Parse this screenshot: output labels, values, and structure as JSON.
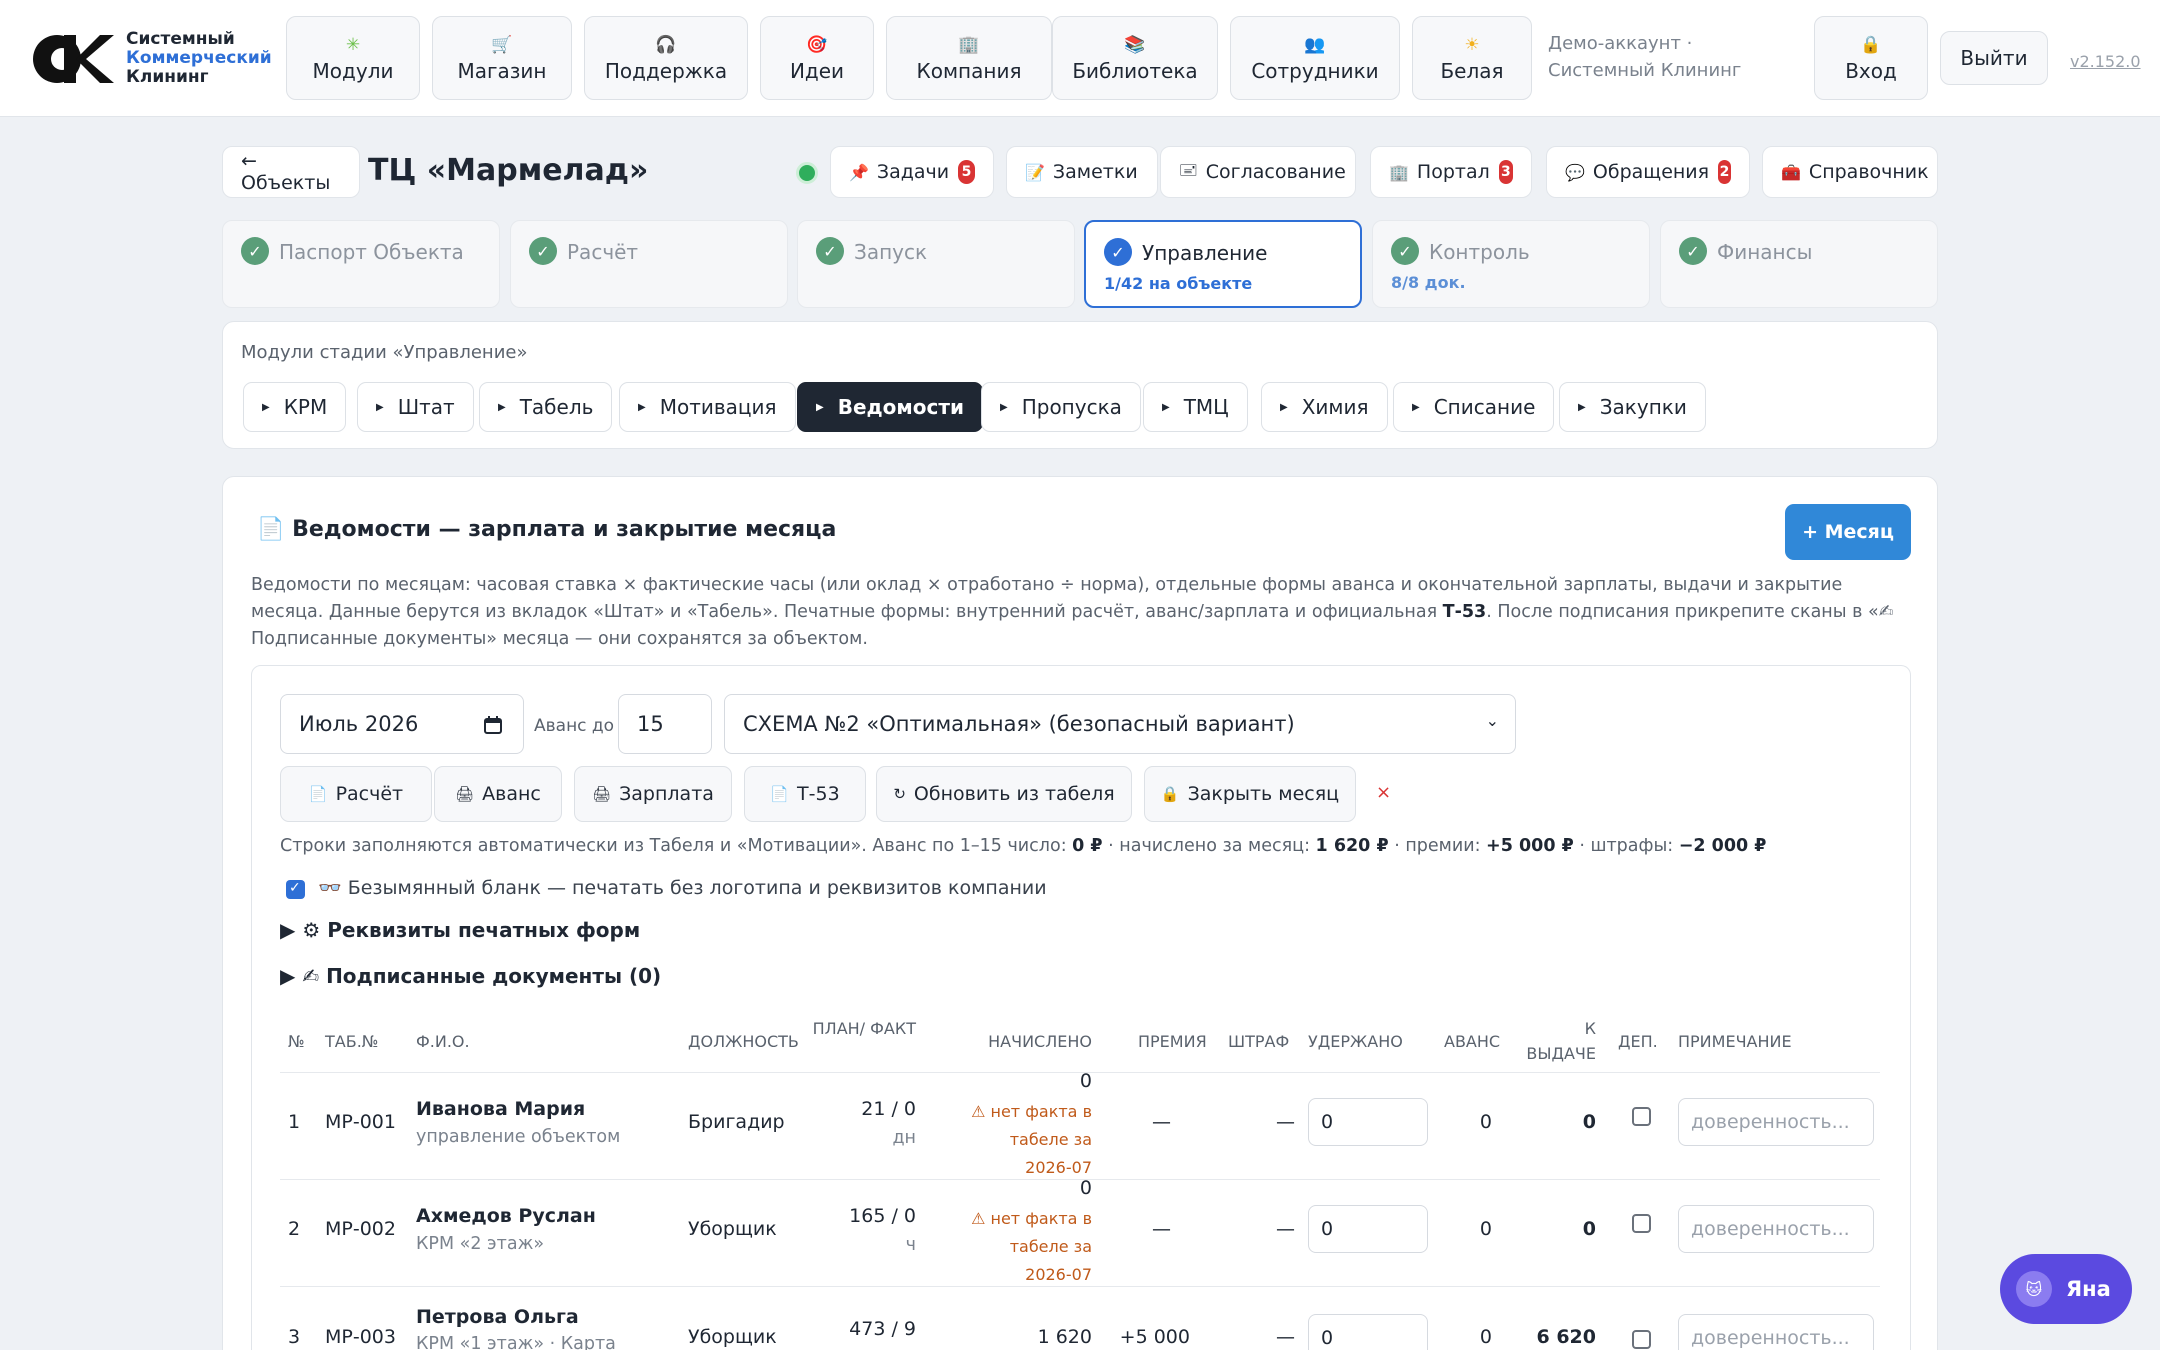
{
  "brand": {
    "line1": "Системный",
    "line2": "Коммерческий",
    "line3": "Клининг"
  },
  "nav": [
    {
      "label": "Модули",
      "icon": "puzzle-icon",
      "glyph": "✳"
    },
    {
      "label": "Магазин",
      "icon": "cart-icon",
      "glyph": "🛒"
    },
    {
      "label": "Поддержка",
      "icon": "headphones-icon",
      "glyph": "🎧"
    },
    {
      "label": "Идеи",
      "icon": "target-icon",
      "glyph": "🎯"
    },
    {
      "label": "Компания",
      "icon": "building-icon",
      "glyph": "🏢"
    },
    {
      "label": "Библиотека",
      "icon": "books-icon",
      "glyph": "📚"
    },
    {
      "label": "Сотрудники",
      "icon": "people-icon",
      "glyph": "👥"
    },
    {
      "label": "Белая",
      "icon": "sun-icon",
      "glyph": "☀"
    }
  ],
  "account": {
    "demo": "Демо-аккаунт · Системный Клининг",
    "login": "Вход",
    "login_glyph": "🔒",
    "logout": "Выйти",
    "version": "v2.152.0"
  },
  "header": {
    "back": "← Объекты",
    "title": "ТЦ «Мармелад»",
    "buttons": [
      {
        "label": "Задачи",
        "glyph": "📌",
        "icon": "pin-icon",
        "badge": "5"
      },
      {
        "label": "Заметки",
        "glyph": "📝",
        "icon": "note-icon"
      },
      {
        "label": "Согласование",
        "glyph": "🖃",
        "icon": "stamp-icon"
      },
      {
        "label": "Портал",
        "glyph": "🏢",
        "icon": "building-icon",
        "badge": "3"
      },
      {
        "label": "Обращения",
        "glyph": "💬",
        "icon": "speech-icon",
        "badge": "2"
      },
      {
        "label": "Справочник",
        "glyph": "🧰",
        "icon": "toolbox-icon"
      }
    ]
  },
  "stages": [
    {
      "label": "Паспорт Объекта",
      "sub": ""
    },
    {
      "label": "Расчёт",
      "sub": ""
    },
    {
      "label": "Запуск",
      "sub": ""
    },
    {
      "label": "Управление",
      "sub": "1/42 на объекте",
      "active": true
    },
    {
      "label": "Контроль",
      "sub": "8/8 док."
    },
    {
      "label": "Финансы",
      "sub": ""
    }
  ],
  "modules": {
    "caption": "Модули стадии «Управление»",
    "items": [
      "КРМ",
      "Штат",
      "Табель",
      "Мотивация",
      "Ведомости",
      "Пропуска",
      "ТМЦ",
      "Химия",
      "Списание",
      "Закупки"
    ],
    "active": "Ведомости"
  },
  "payroll": {
    "title": "Ведомости — зарплата и закрытие месяца",
    "title_glyph": "📄",
    "add_month": "+ Месяц",
    "desc_1": "Ведомости по месяцам: часовая ставка × фактические часы (или оклад × отработано ÷ норма), отдельные формы аванса и окончательной зарплаты, выдачи и закрытие месяца. Данные берутся из вкладок «Штат» и «Табель». Печатные формы: внутренний расчёт, аванс/зарплата и официальная ",
    "desc_bold": "Т-53",
    "desc_2": ". После подписания прикрепите сканы в «✍ Подписанные документы» месяца — они сохранятся за объектом.",
    "month": "Июль 2026",
    "avans_label": "Аванс до",
    "avans_day": "15",
    "scheme": "СХЕМА №2 «Оптимальная» (безопасный вариант)",
    "actions": [
      {
        "label": "Расчёт",
        "glyph": "📄",
        "icon": "document-icon"
      },
      {
        "label": "Аванс",
        "glyph": "🖨",
        "icon": "printer-icon"
      },
      {
        "label": "Зарплата",
        "glyph": "🖨",
        "icon": "printer-icon"
      },
      {
        "label": "Т-53",
        "glyph": "📄",
        "icon": "document-icon"
      },
      {
        "label": "Обновить из табеля",
        "glyph": "↻",
        "icon": "refresh-icon"
      },
      {
        "label": "Закрыть месяц",
        "glyph": "🔒",
        "icon": "lock-icon"
      }
    ],
    "clear_glyph": "×",
    "info": {
      "prefix": "Строки заполняются автоматически из Табеля и «Мотивации». Аванс по 1–15 число: ",
      "avans": "0 ₽",
      "mid1": " · начислено за месяц: ",
      "accrued": "1 620 ₽",
      "mid2": " · премии: ",
      "bonus": "+5 000 ₽",
      "mid3": " · штрафы: ",
      "fines": "−2 000 ₽"
    },
    "blank_label": "👓 Безымянный бланк — печатать без логотипа и реквизитов компании",
    "blank_checked": true,
    "details": [
      "⚙ Реквизиты печатных форм",
      "✍ Подписанные документы (0)"
    ],
    "columns": [
      "№",
      "ТАБ.№",
      "Ф.И.О.",
      "ДОЛЖНОСТЬ",
      "ПЛАН/ ФАКТ",
      "НАЧИСЛЕНО",
      "ПРЕМИЯ",
      "ШТРАФ",
      "УДЕРЖАНО",
      "АВАНС",
      "К ВЫДАЧЕ",
      "ДЕП.",
      "ПРИМЕЧАНИЕ"
    ],
    "rows": [
      {
        "n": "1",
        "tab": "МР-001",
        "name": "Иванова Мария",
        "sub": "управление объектом",
        "pos": "Бригадир",
        "plan": "21 / 0",
        "unit": "дн",
        "accrued": "0",
        "warn1": "⚠ нет факта в табеле за",
        "warn2": "2026-07",
        "bonus": "—",
        "fine": "—",
        "held": "0",
        "avans": "0",
        "payout": "0",
        "note_ph": "доверенность..."
      },
      {
        "n": "2",
        "tab": "МР-002",
        "name": "Ахмедов Руслан",
        "sub": "КРМ «2 этаж»",
        "pos": "Уборщик",
        "plan": "165 / 0",
        "unit": "ч",
        "accrued": "0",
        "warn1": "⚠ нет факта в табеле за",
        "warn2": "2026-07",
        "bonus": "—",
        "fine": "—",
        "held": "0",
        "avans": "0",
        "payout": "0",
        "note_ph": "доверенность..."
      },
      {
        "n": "3",
        "tab": "МР-003",
        "name": "Петрова Ольга",
        "sub": "КРМ «1 этаж» · Карта",
        "pos": "Уборщик",
        "plan": "473 / 9",
        "accrued": "1 620",
        "bonus": "+5 000",
        "fine": "—",
        "held": "0",
        "avans": "0",
        "payout": "6 620",
        "note_ph": "доверенность..."
      }
    ]
  },
  "assistant": {
    "label": "Яна",
    "glyph": "🐱"
  }
}
